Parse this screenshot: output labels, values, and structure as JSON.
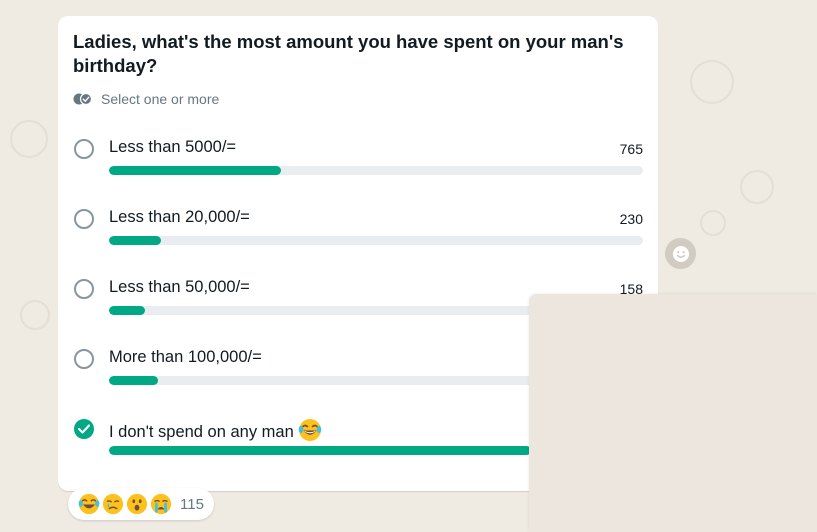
{
  "poll": {
    "question": "Ladies, what's the most amount you have spent on your man's birthday?",
    "hint": "Select one or more",
    "options": [
      {
        "label": "Less than 5000/=",
        "votes": "765",
        "fraction": 0.323
      },
      {
        "label": "Less than 20,000/=",
        "votes": "230",
        "fraction": 0.097
      },
      {
        "label": "Less than 50,000/=",
        "votes": "158",
        "fraction": 0.067
      },
      {
        "label": "More than 100,000/=",
        "votes": "",
        "fraction": 0.092
      },
      {
        "label": "I don't spend on any man",
        "votes": "",
        "fraction": 0.79,
        "selected": true,
        "emoji": "tears-of-joy"
      }
    ]
  },
  "reactions": {
    "emojis": [
      "tears-of-joy",
      "sad-tear",
      "astonished",
      "loudly-crying"
    ],
    "count": "115"
  },
  "colors": {
    "accent": "#00a884",
    "track": "#e9edef",
    "background": "#efeae2",
    "text": "#111b21",
    "muted": "#667781"
  }
}
